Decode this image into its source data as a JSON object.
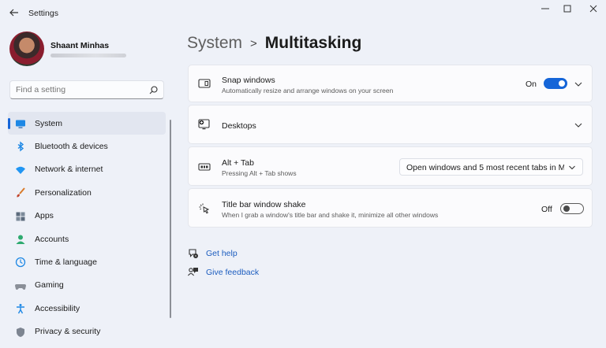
{
  "window": {
    "title": "Settings"
  },
  "profile": {
    "name": "Shaant Minhas"
  },
  "search": {
    "placeholder": "Find a setting"
  },
  "sidebar": {
    "items": [
      {
        "label": "System",
        "icon": "monitor-icon",
        "selected": true
      },
      {
        "label": "Bluetooth & devices",
        "icon": "bluetooth-icon"
      },
      {
        "label": "Network & internet",
        "icon": "wifi-icon"
      },
      {
        "label": "Personalization",
        "icon": "brush-icon"
      },
      {
        "label": "Apps",
        "icon": "apps-icon"
      },
      {
        "label": "Accounts",
        "icon": "person-icon"
      },
      {
        "label": "Time & language",
        "icon": "globe-clock-icon"
      },
      {
        "label": "Gaming",
        "icon": "gamepad-icon"
      },
      {
        "label": "Accessibility",
        "icon": "accessibility-icon"
      },
      {
        "label": "Privacy & security",
        "icon": "shield-icon"
      }
    ]
  },
  "breadcrumb": {
    "parent": "System",
    "separator": ">",
    "current": "Multitasking"
  },
  "settings": {
    "snap": {
      "title": "Snap windows",
      "desc": "Automatically resize and arrange windows on your screen",
      "state": "On"
    },
    "desktops": {
      "title": "Desktops"
    },
    "alttab": {
      "title": "Alt + Tab",
      "desc": "Pressing Alt + Tab shows",
      "value": "Open windows and 5 most recent tabs in M"
    },
    "shake": {
      "title": "Title bar window shake",
      "desc": "When I grab a window's title bar and shake it, minimize all other windows",
      "state": "Off"
    }
  },
  "links": {
    "help": "Get help",
    "feedback": "Give feedback"
  },
  "colors": {
    "accent": "#1565d8",
    "link": "#1c5dbf",
    "background": "#eef1f8",
    "card": "#fbfbfd"
  }
}
